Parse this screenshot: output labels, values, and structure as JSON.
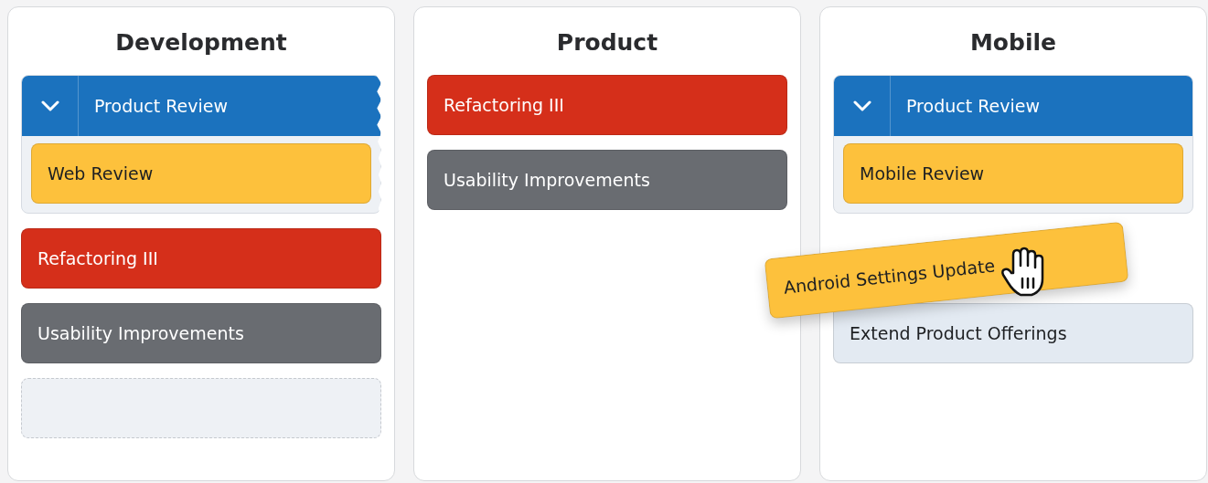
{
  "columns": [
    {
      "title": "Development",
      "items": [
        {
          "kind": "group",
          "title": "Product Review",
          "expanded": true,
          "torn": true,
          "children": [
            {
              "label": "Web Review",
              "color": "#fdc13c"
            }
          ]
        },
        {
          "kind": "card",
          "label": "Refactoring III",
          "color": "#d52f1a"
        },
        {
          "kind": "card",
          "label": "Usability Improvements",
          "color": "#696c71"
        },
        {
          "kind": "placeholder"
        }
      ]
    },
    {
      "title": "Product",
      "items": [
        {
          "kind": "card",
          "label": "Refactoring III",
          "color": "#d52f1a"
        },
        {
          "kind": "card",
          "label": "Usability Improvements",
          "color": "#696c71"
        }
      ]
    },
    {
      "title": "Mobile",
      "items": [
        {
          "kind": "group",
          "title": "Product Review",
          "expanded": true,
          "torn": false,
          "children": [
            {
              "label": "Mobile Review",
              "color": "#fdc13c"
            }
          ]
        },
        {
          "kind": "dragging",
          "label": "Android Settings Update",
          "color": "#fdc13c"
        },
        {
          "kind": "card",
          "label": "Extend Product Offerings",
          "color": "#e3eaf2"
        }
      ]
    }
  ]
}
